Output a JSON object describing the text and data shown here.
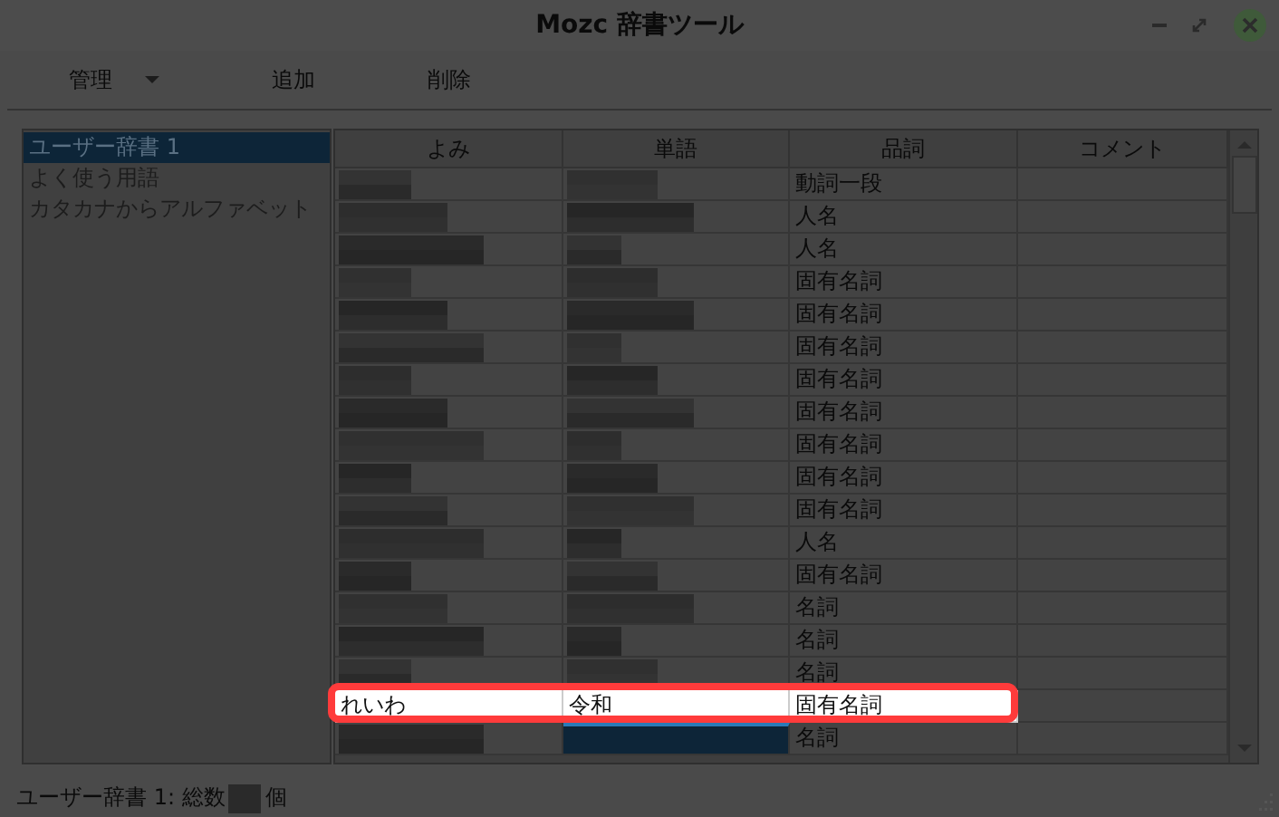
{
  "window": {
    "title": "Mozc 辞書ツール"
  },
  "toolbar": [
    {
      "label": "管理",
      "kind": "menu"
    },
    {
      "label": "追加",
      "kind": "button"
    },
    {
      "label": "削除",
      "kind": "button"
    }
  ],
  "sidebar": {
    "items": [
      {
        "label": "ユーザー辞書 1",
        "selected": true
      },
      {
        "label": "よく使う用語",
        "selected": false
      },
      {
        "label": "カタカナからアルファベット",
        "selected": false
      }
    ]
  },
  "table": {
    "columns": [
      "よみ",
      "単語",
      "品詞",
      "コメント"
    ],
    "rows": [
      {
        "cells": [
          {
            "kind": "mosaic"
          },
          {
            "kind": "mosaic"
          },
          {
            "kind": "text",
            "text": "動詞一段"
          }
        ],
        "highlighted": false,
        "selected": false
      },
      {
        "cells": [
          {
            "kind": "mosaic"
          },
          {
            "kind": "mosaic"
          },
          {
            "kind": "text",
            "text": "人名"
          }
        ],
        "highlighted": false,
        "selected": false
      },
      {
        "cells": [
          {
            "kind": "mosaic"
          },
          {
            "kind": "mosaic"
          },
          {
            "kind": "text",
            "text": "人名"
          }
        ],
        "highlighted": false,
        "selected": false
      },
      {
        "cells": [
          {
            "kind": "mosaic"
          },
          {
            "kind": "mosaic"
          },
          {
            "kind": "text",
            "text": "固有名詞"
          }
        ],
        "highlighted": false,
        "selected": false
      },
      {
        "cells": [
          {
            "kind": "mosaic"
          },
          {
            "kind": "mosaic"
          },
          {
            "kind": "text",
            "text": "固有名詞"
          }
        ],
        "highlighted": false,
        "selected": false
      },
      {
        "cells": [
          {
            "kind": "mosaic"
          },
          {
            "kind": "mosaic"
          },
          {
            "kind": "text",
            "text": "固有名詞"
          }
        ],
        "highlighted": false,
        "selected": false
      },
      {
        "cells": [
          {
            "kind": "mosaic"
          },
          {
            "kind": "mosaic"
          },
          {
            "kind": "text",
            "text": "固有名詞"
          }
        ],
        "highlighted": false,
        "selected": false
      },
      {
        "cells": [
          {
            "kind": "mosaic"
          },
          {
            "kind": "mosaic"
          },
          {
            "kind": "text",
            "text": "固有名詞"
          }
        ],
        "highlighted": false,
        "selected": false
      },
      {
        "cells": [
          {
            "kind": "mosaic"
          },
          {
            "kind": "mosaic"
          },
          {
            "kind": "text",
            "text": "固有名詞"
          }
        ],
        "highlighted": false,
        "selected": false
      },
      {
        "cells": [
          {
            "kind": "mosaic"
          },
          {
            "kind": "mosaic"
          },
          {
            "kind": "text",
            "text": "固有名詞"
          }
        ],
        "highlighted": false,
        "selected": false
      },
      {
        "cells": [
          {
            "kind": "mosaic"
          },
          {
            "kind": "mosaic"
          },
          {
            "kind": "text",
            "text": "固有名詞"
          }
        ],
        "highlighted": false,
        "selected": false
      },
      {
        "cells": [
          {
            "kind": "mosaic"
          },
          {
            "kind": "mosaic"
          },
          {
            "kind": "text",
            "text": "人名"
          }
        ],
        "highlighted": false,
        "selected": false
      },
      {
        "cells": [
          {
            "kind": "mosaic"
          },
          {
            "kind": "mosaic"
          },
          {
            "kind": "text",
            "text": "固有名詞"
          }
        ],
        "highlighted": false,
        "selected": false
      },
      {
        "cells": [
          {
            "kind": "mosaic"
          },
          {
            "kind": "mosaic"
          },
          {
            "kind": "text",
            "text": "名詞"
          }
        ],
        "highlighted": false,
        "selected": false
      },
      {
        "cells": [
          {
            "kind": "mosaic"
          },
          {
            "kind": "mosaic"
          },
          {
            "kind": "text",
            "text": "名詞"
          }
        ],
        "highlighted": false,
        "selected": false
      },
      {
        "cells": [
          {
            "kind": "mosaic"
          },
          {
            "kind": "mosaic"
          },
          {
            "kind": "text",
            "text": "名詞"
          }
        ],
        "highlighted": false,
        "selected": false
      },
      {
        "cells": [
          {
            "kind": "text",
            "text": "れいわ"
          },
          {
            "kind": "text",
            "text": "令和"
          },
          {
            "kind": "text",
            "text": "固有名詞"
          }
        ],
        "highlighted": true,
        "selected": false
      },
      {
        "cells": [
          {
            "kind": "mosaic"
          },
          {
            "kind": "mosaic"
          },
          {
            "kind": "text",
            "text": "名詞"
          }
        ],
        "highlighted": false,
        "selected": true
      }
    ]
  },
  "status_bar": {
    "prefix": "ユーザー辞書 1: 総数",
    "suffix": "個",
    "count_masked": true
  }
}
